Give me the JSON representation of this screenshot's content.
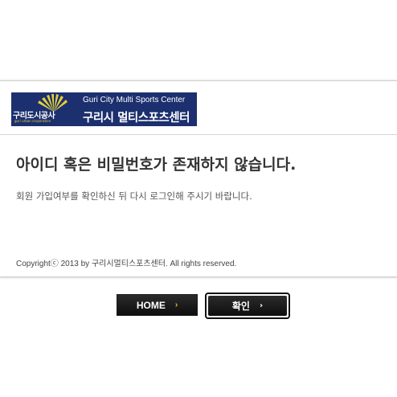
{
  "logo": {
    "org_name": "구리도시공사",
    "org_sub": "guri urban corporation",
    "center_name_en": "Guri City Multi Sports Center",
    "center_name_ko": "구리시 멀티스포츠센터",
    "colors": {
      "background": "#1c2f6e",
      "sun": "#e4cf3a"
    }
  },
  "message": {
    "title": "아이디 혹은 비밀번호가 존재하지 않습니다.",
    "body": "회원 가입여부를 확인하신 뒤 다시 로그인해 주시기 바랍니다."
  },
  "footer": {
    "copyright": "Copyrightⓒ 2013 by 구리시멀티스포츠센터. All rights reserved."
  },
  "buttons": {
    "home_label": "HOME",
    "home_arrow_icon": "chevron-right-icon",
    "confirm_label": "확인",
    "confirm_arrow_icon": "chevron-right-icon"
  }
}
